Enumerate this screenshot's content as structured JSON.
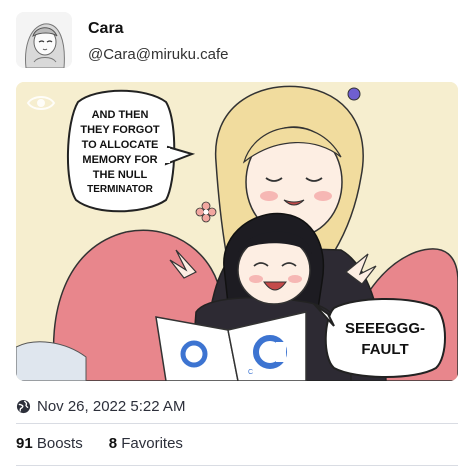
{
  "author": {
    "display_name": "Cara",
    "handle": "@Cara@miruku.cafe",
    "avatar_icon": "avatar-anime-girl"
  },
  "media": {
    "speech_bubble_left": [
      "AND THEN",
      "THEY FORGOT",
      "TO ALLOCATE",
      "MEMORY FOR",
      "THE NULL",
      "TERMINATOR"
    ],
    "speech_bubble_right": [
      "SEEEGGG-",
      "FAULT"
    ],
    "book_letter": "C",
    "hide_media_icon": "eye-icon"
  },
  "timestamp": {
    "icon": "globe-icon",
    "text": "Nov 26, 2022 5:22 AM"
  },
  "stats": {
    "boosts_count": "91",
    "boosts_label": "Boosts",
    "favorites_count": "8",
    "favorites_label": "Favorites"
  },
  "colors": {
    "background": "#ffffff",
    "text": "#2c2f3a",
    "divider": "#d9dce3",
    "media_bg": "#f6eecf"
  }
}
